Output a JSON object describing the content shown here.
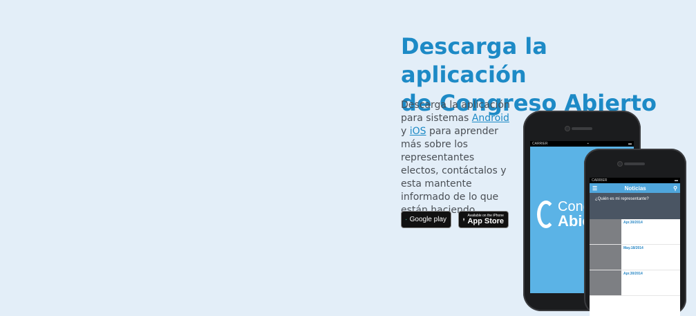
{
  "headline": {
    "line1": "Descarga la aplicación",
    "line2": "de Congreso Abierto"
  },
  "body": {
    "part1": "Descarga la aplicación para sistemas ",
    "android_link": "Android",
    "part2": " y ",
    "ios_link": "iOS",
    "part3": " para aprender más sobre los representantes electos, contáctalos y esta mantente informado de lo que están haciendo."
  },
  "badges": {
    "google_label": "Google play",
    "apple_small": "Available on the iPhone",
    "apple_big": "App Store"
  },
  "phone_back": {
    "carrier": "CARRIER",
    "logo_line1": "Congr",
    "logo_line2": "Abie"
  },
  "phone_front": {
    "carrier": "CARRIER",
    "nav_title": "Noticias",
    "hero_text": "¿Quién es mi representante?",
    "news": [
      {
        "date": "Apr.30/2014"
      },
      {
        "date": "May.18/2014"
      },
      {
        "date": "Apr.30/2014"
      }
    ]
  },
  "colors": {
    "background": "#e3eef8",
    "accent": "#1d8ac6",
    "body_text": "#4a4f55",
    "app_blue": "#5bb3e6"
  }
}
